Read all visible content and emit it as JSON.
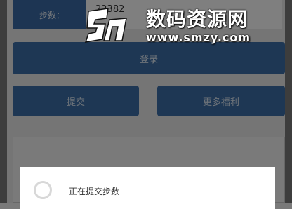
{
  "form": {
    "steps_label": "步数：",
    "steps_value": "22382"
  },
  "buttons": {
    "login": "登录",
    "submit": "提交",
    "more_benefits": "更多福利"
  },
  "dialog": {
    "message": "正在提交步数"
  },
  "watermark": {
    "title": "数码资源网",
    "url": "www.smzy.com"
  }
}
